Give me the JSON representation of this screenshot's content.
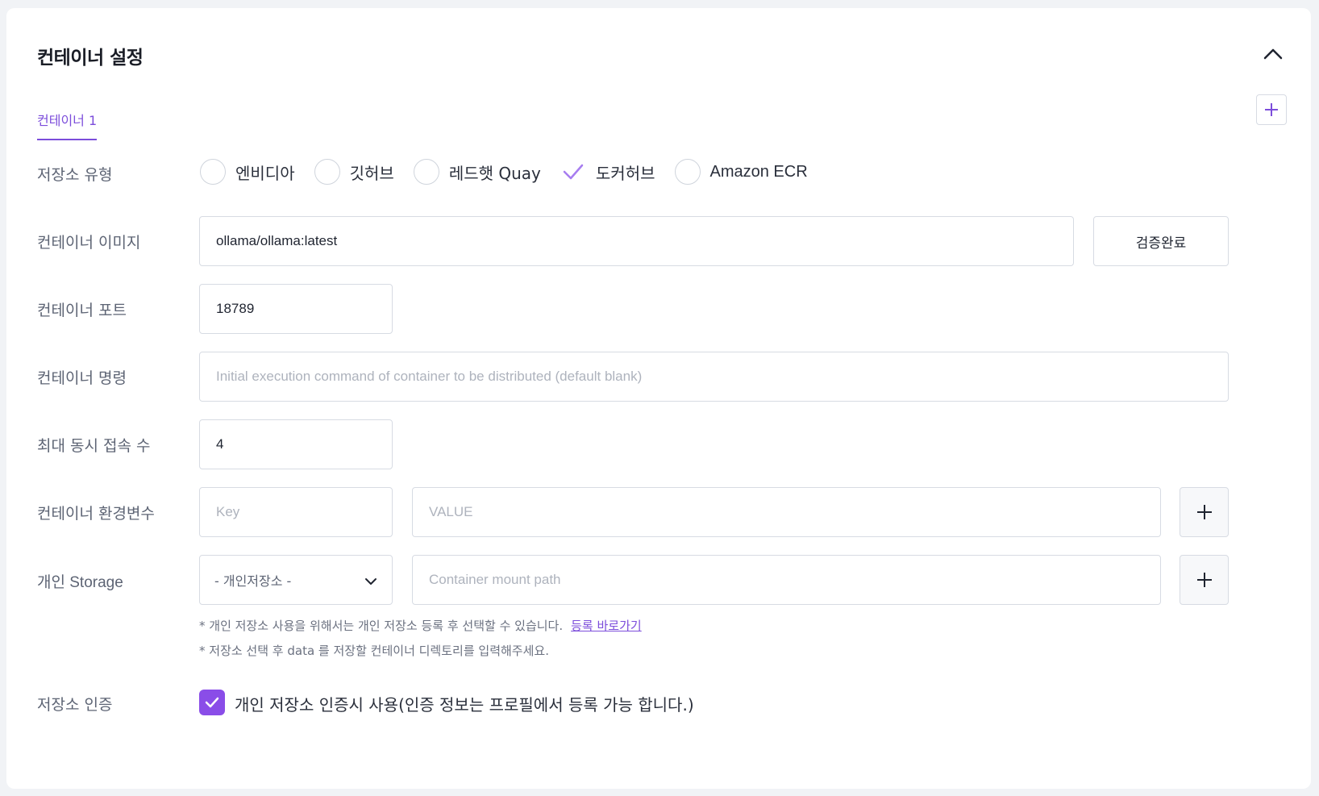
{
  "section": {
    "title": "컨테이너 설정",
    "collapse_icon": "chevron-up-icon"
  },
  "tabs": [
    {
      "label": "컨테이너 1",
      "active": true
    }
  ],
  "accent_color": "#7c4ddb",
  "form": {
    "registry_type": {
      "label": "저장소 유형",
      "options": [
        {
          "label": "엔비디아",
          "selected": false
        },
        {
          "label": "깃허브",
          "selected": false
        },
        {
          "label": "레드햇 Quay",
          "selected": false
        },
        {
          "label": "도커허브",
          "selected": true
        },
        {
          "label": "Amazon ECR",
          "selected": false
        }
      ]
    },
    "image": {
      "label": "컨테이너 이미지",
      "value": "ollama/ollama:latest",
      "verify_button": "검증완료"
    },
    "port": {
      "label": "컨테이너 포트",
      "value": "18789"
    },
    "command": {
      "label": "컨테이너 명령",
      "value": "",
      "placeholder": "Initial execution command of container to be distributed (default blank)"
    },
    "max_connections": {
      "label": "최대 동시 접속 수",
      "value": "4"
    },
    "env": {
      "label": "컨테이너 환경변수",
      "key_placeholder": "Key",
      "value_placeholder": "VALUE"
    },
    "storage": {
      "label": "개인 Storage",
      "select_value": "- 개인저장소 -",
      "mount_placeholder": "Container mount path",
      "hint1": "* 개인 저장소 사용을 위해서는 개인 저장소 등록 후 선택할 수 있습니다.",
      "hint1_link": "등록 바로가기",
      "hint2": "* 저장소 선택 후 data 를 저장할 컨테이너 디렉토리를 입력해주세요."
    },
    "auth": {
      "label": "저장소 인증",
      "checkbox_label": "개인 저장소 인증시 사용(인증 정보는 프로필에서 등록 가능 합니다.)",
      "checked": true
    }
  }
}
